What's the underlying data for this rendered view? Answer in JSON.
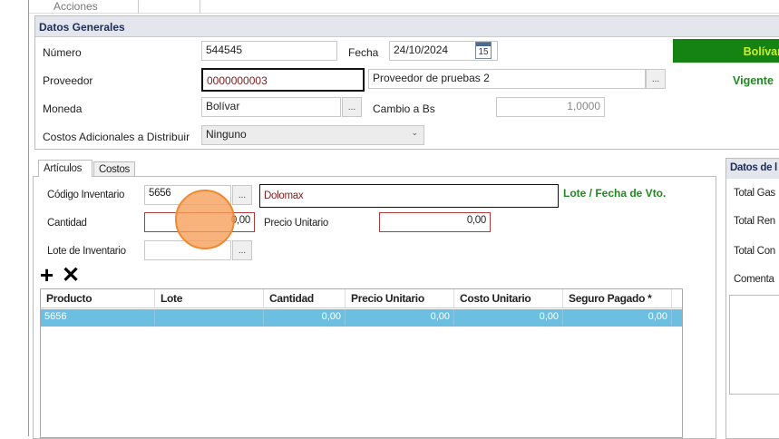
{
  "top_tab": "Acciones",
  "general": {
    "title": "Datos Generales",
    "numero_label": "Número",
    "numero": "544545",
    "fecha_label": "Fecha",
    "fecha": "24/10/2024",
    "calendar_day": "15",
    "proveedor_label": "Proveedor",
    "proveedor_code": "0000000003",
    "proveedor_name": "Proveedor de pruebas 2",
    "moneda_label": "Moneda",
    "moneda": "Bolívar",
    "cambio_label": "Cambio a Bs",
    "cambio": "1,0000",
    "costos_label": "Costos Adicionales a Distribuir",
    "costos": "Ninguno",
    "currency_badge": "Bolívar",
    "status": "Vigente",
    "ellipsis": "..."
  },
  "colors": {
    "badge_bg": "#148314",
    "badge_text": "#c8f02a",
    "status": "#1f8a1f",
    "selected_row": "#6cbfe0",
    "header_bg": "#e3e6ec",
    "error_border": "#b03a3a"
  },
  "tabs": [
    {
      "label": "Artículos",
      "active": true
    },
    {
      "label": "Costos",
      "active": false
    }
  ],
  "articulos": {
    "codigo_label": "Código Inventario",
    "codigo": "5656",
    "descripcion": "Dolomax",
    "lote_vto": "Lote / Fecha de Vto.",
    "cantidad_label": "Cantidad",
    "cantidad": "0,00",
    "precio_label": "Precio Unitario",
    "precio": "0,00",
    "lote_label": "Lote de Inventario",
    "lote": ""
  },
  "grid": {
    "columns": [
      "Producto",
      "Lote",
      "Cantidad",
      "Precio Unitario",
      "Costo Unitario",
      "Seguro Pagado *"
    ],
    "rows": [
      [
        "5656",
        "",
        "0,00",
        "0,00",
        "0,00",
        "0,00"
      ]
    ]
  },
  "right_panel": {
    "title": "Datos de l",
    "items": [
      "Total Gas",
      "Total Ren",
      "Total Con",
      "Comenta"
    ]
  }
}
